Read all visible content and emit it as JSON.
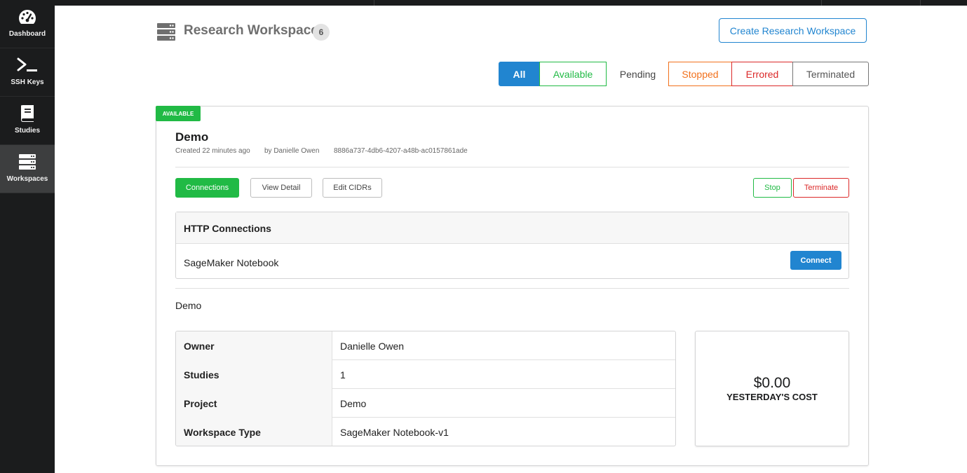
{
  "sidebar": {
    "items": [
      {
        "label": "Dashboard",
        "icon": "dashboard-icon"
      },
      {
        "label": "SSH Keys",
        "icon": "terminal-icon"
      },
      {
        "label": "Studies",
        "icon": "book-icon"
      },
      {
        "label": "Workspaces",
        "icon": "server-icon",
        "active": true
      }
    ]
  },
  "header": {
    "title": "Research Workspaces",
    "count": "6",
    "create_label": "Create Research Workspace"
  },
  "filters": {
    "all": "All",
    "available": "Available",
    "pending": "Pending",
    "stopped": "Stopped",
    "errored": "Errored",
    "terminated": "Terminated"
  },
  "workspace": {
    "status": "AVAILABLE",
    "name": "Demo",
    "created": "Created 22 minutes ago",
    "by": "by Danielle Owen",
    "id": "8886a737-4db6-4207-a48b-ac0157861ade",
    "actions": {
      "connections": "Connections",
      "view_detail": "View Detail",
      "edit_cidrs": "Edit CIDRs",
      "stop": "Stop",
      "terminate": "Terminate"
    },
    "http": {
      "title": "HTTP Connections",
      "name": "SageMaker Notebook",
      "connect": "Connect"
    },
    "description": "Demo",
    "properties": [
      {
        "key": "Owner",
        "value": "Danielle Owen"
      },
      {
        "key": "Studies",
        "value": "1"
      },
      {
        "key": "Project",
        "value": "Demo"
      },
      {
        "key": "Workspace Type",
        "value": "SageMaker Notebook-v1"
      }
    ],
    "cost": {
      "value": "$0.00",
      "label": "YESTERDAY'S COST"
    }
  },
  "colors": {
    "primary": "#2185d0",
    "green": "#21ba45",
    "orange": "#f2711c",
    "red": "#db2828",
    "sidebar": "#1b1c1d"
  }
}
